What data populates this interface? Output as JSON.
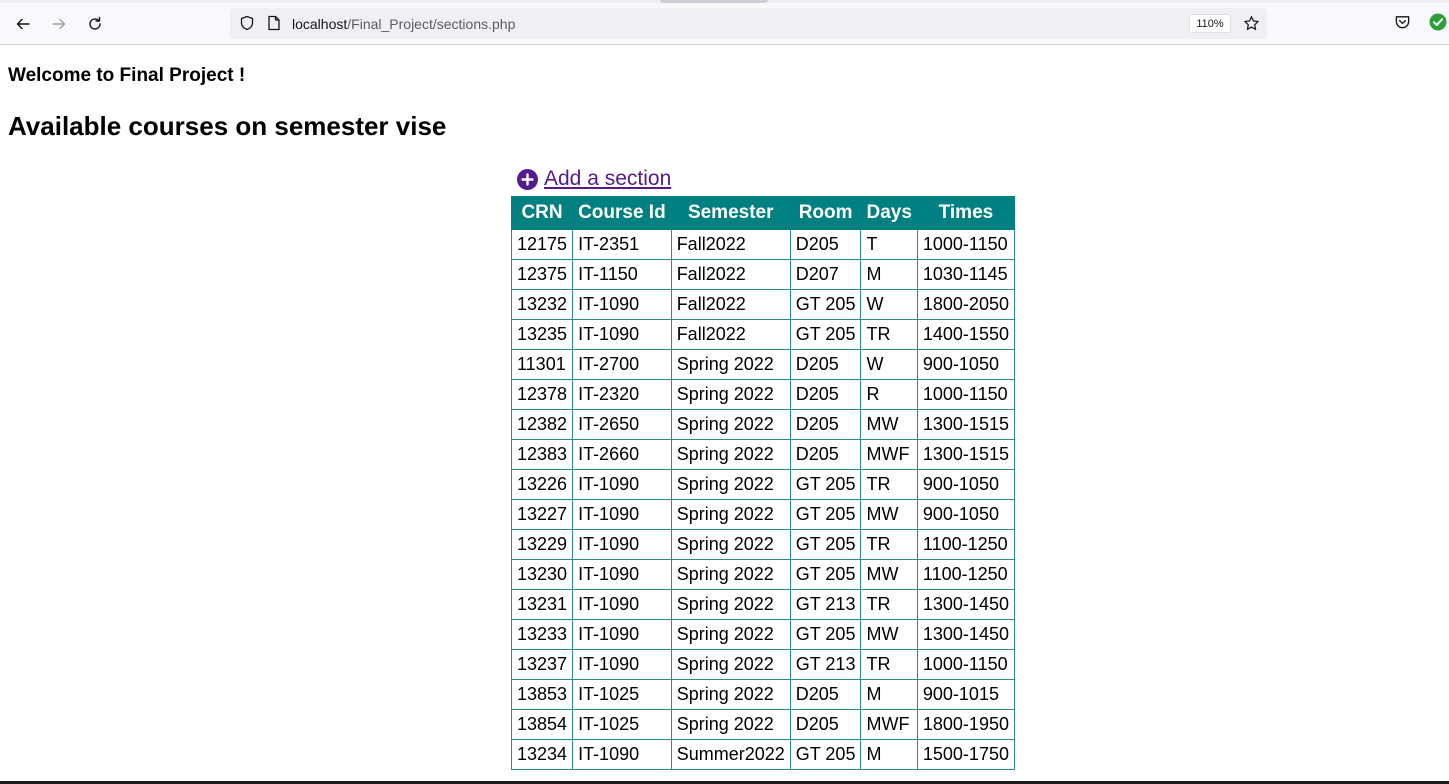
{
  "browser": {
    "url_host": "localhost",
    "url_path": "/Final_Project/sections.php",
    "zoom": "110%",
    "icons": [
      "back-arrow-icon",
      "forward-arrow-icon",
      "reload-icon",
      "shield-icon",
      "page-icon",
      "star-icon",
      "pocket-icon",
      "extension-check-icon"
    ]
  },
  "page": {
    "welcome": "Welcome to Final Project !",
    "title": "Available courses on semester vise",
    "add_link": "Add a section",
    "add_icon": "plus-circle-icon",
    "colors": {
      "header_bg": "#008080",
      "link": "#551a8b",
      "border": "#2e8b8b"
    }
  },
  "table": {
    "columns": [
      "CRN",
      "Course Id",
      "Semester",
      "Room",
      "Days",
      "Times"
    ],
    "rows": [
      [
        "12175",
        "IT-2351",
        "Fall2022",
        "D205",
        "T",
        "1000-1150"
      ],
      [
        "12375",
        "IT-1150",
        "Fall2022",
        "D207",
        "M",
        "1030-1145"
      ],
      [
        "13232",
        "IT-1090",
        "Fall2022",
        "GT 205",
        "W",
        "1800-2050"
      ],
      [
        "13235",
        "IT-1090",
        "Fall2022",
        "GT 205",
        "TR",
        "1400-1550"
      ],
      [
        "11301",
        "IT-2700",
        "Spring 2022",
        "D205",
        "W",
        "900-1050"
      ],
      [
        "12378",
        "IT-2320",
        "Spring 2022",
        "D205",
        "R",
        "1000-1150"
      ],
      [
        "12382",
        "IT-2650",
        "Spring 2022",
        "D205",
        "MW",
        "1300-1515"
      ],
      [
        "12383",
        "IT-2660",
        "Spring 2022",
        "D205",
        "MWF",
        "1300-1515"
      ],
      [
        "13226",
        "IT-1090",
        "Spring 2022",
        "GT 205",
        "TR",
        "900-1050"
      ],
      [
        "13227",
        "IT-1090",
        "Spring 2022",
        "GT 205",
        "MW",
        "900-1050"
      ],
      [
        "13229",
        "IT-1090",
        "Spring 2022",
        "GT 205",
        "TR",
        "1100-1250"
      ],
      [
        "13230",
        "IT-1090",
        "Spring 2022",
        "GT 205",
        "MW",
        "1100-1250"
      ],
      [
        "13231",
        "IT-1090",
        "Spring 2022",
        "GT 213",
        "TR",
        "1300-1450"
      ],
      [
        "13233",
        "IT-1090",
        "Spring 2022",
        "GT 205",
        "MW",
        "1300-1450"
      ],
      [
        "13237",
        "IT-1090",
        "Spring 2022",
        "GT 213",
        "TR",
        "1000-1150"
      ],
      [
        "13853",
        "IT-1025",
        "Spring 2022",
        "D205",
        "M",
        "900-1015"
      ],
      [
        "13854",
        "IT-1025",
        "Spring 2022",
        "D205",
        "MWF",
        "1800-1950"
      ],
      [
        "13234",
        "IT-1090",
        "Summer2022",
        "GT 205",
        "M",
        "1500-1750"
      ]
    ]
  }
}
